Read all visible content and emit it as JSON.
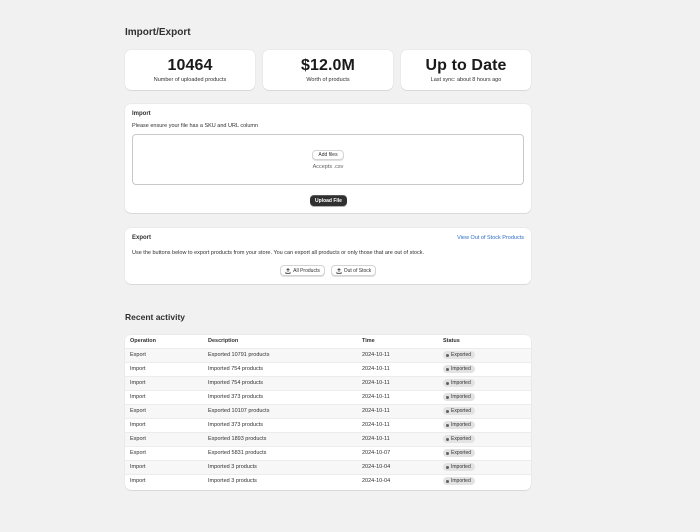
{
  "page": {
    "title": "Import/Export"
  },
  "stats": [
    {
      "value": "10464",
      "label": "Number of uploaded products"
    },
    {
      "value": "$12.0M",
      "label": "Worth of products"
    },
    {
      "value": "Up to Date",
      "label": "Last sync: about 8 hours ago"
    }
  ],
  "import": {
    "title": "Import",
    "hint": "Please ensure your file has a SKU and URL column",
    "add_files_label": "Add files",
    "accepts_text": "Accepts .csv",
    "upload_label": "Upload File"
  },
  "export": {
    "title": "Export",
    "link_label": "View Out of Stock Products",
    "description": "Use the buttons below to export products from your store. You can export all products or only those that are out of stock.",
    "all_products_label": "All Products",
    "out_of_stock_label": "Out of Stock"
  },
  "activity": {
    "title": "Recent activity",
    "columns": [
      "Operation",
      "Description",
      "Time",
      "Status"
    ],
    "rows": [
      {
        "operation": "Export",
        "description": "Exported 10791 products",
        "time": "2024-10-11",
        "status": "Exported"
      },
      {
        "operation": "Import",
        "description": "Imported 754 products",
        "time": "2024-10-11",
        "status": "Imported"
      },
      {
        "operation": "Import",
        "description": "Imported 754 products",
        "time": "2024-10-11",
        "status": "Imported"
      },
      {
        "operation": "Import",
        "description": "Imported 373 products",
        "time": "2024-10-11",
        "status": "Imported"
      },
      {
        "operation": "Export",
        "description": "Exported 10107 products",
        "time": "2024-10-11",
        "status": "Exported"
      },
      {
        "operation": "Import",
        "description": "Imported 373 products",
        "time": "2024-10-11",
        "status": "Imported"
      },
      {
        "operation": "Export",
        "description": "Exported 1893 products",
        "time": "2024-10-11",
        "status": "Exported"
      },
      {
        "operation": "Export",
        "description": "Exported 5831 products",
        "time": "2024-10-07",
        "status": "Exported"
      },
      {
        "operation": "Import",
        "description": "Imported 3 products",
        "time": "2024-10-04",
        "status": "Imported"
      },
      {
        "operation": "Import",
        "description": "Imported 3 products",
        "time": "2024-10-04",
        "status": "Imported"
      }
    ]
  }
}
